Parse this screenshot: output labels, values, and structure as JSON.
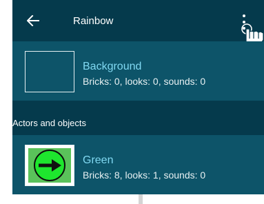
{
  "appbar": {
    "title": "Rainbow",
    "back_icon": "arrow-left-icon",
    "menu_icon": "more-vert-icon"
  },
  "background_item": {
    "name": "Background",
    "stats": "Bricks: 0, looks: 0, sounds: 0"
  },
  "section": {
    "label": "Actors and objects"
  },
  "actors": [
    {
      "name": "Green",
      "stats": "Bricks: 8, looks: 1, sounds: 0",
      "thumbnail": "green-circle-arrow"
    }
  ],
  "colors": {
    "appbar": "#053a4c",
    "row": "#0d5469",
    "accent_text": "#80d9f2",
    "green_object": "#1ee62e"
  }
}
